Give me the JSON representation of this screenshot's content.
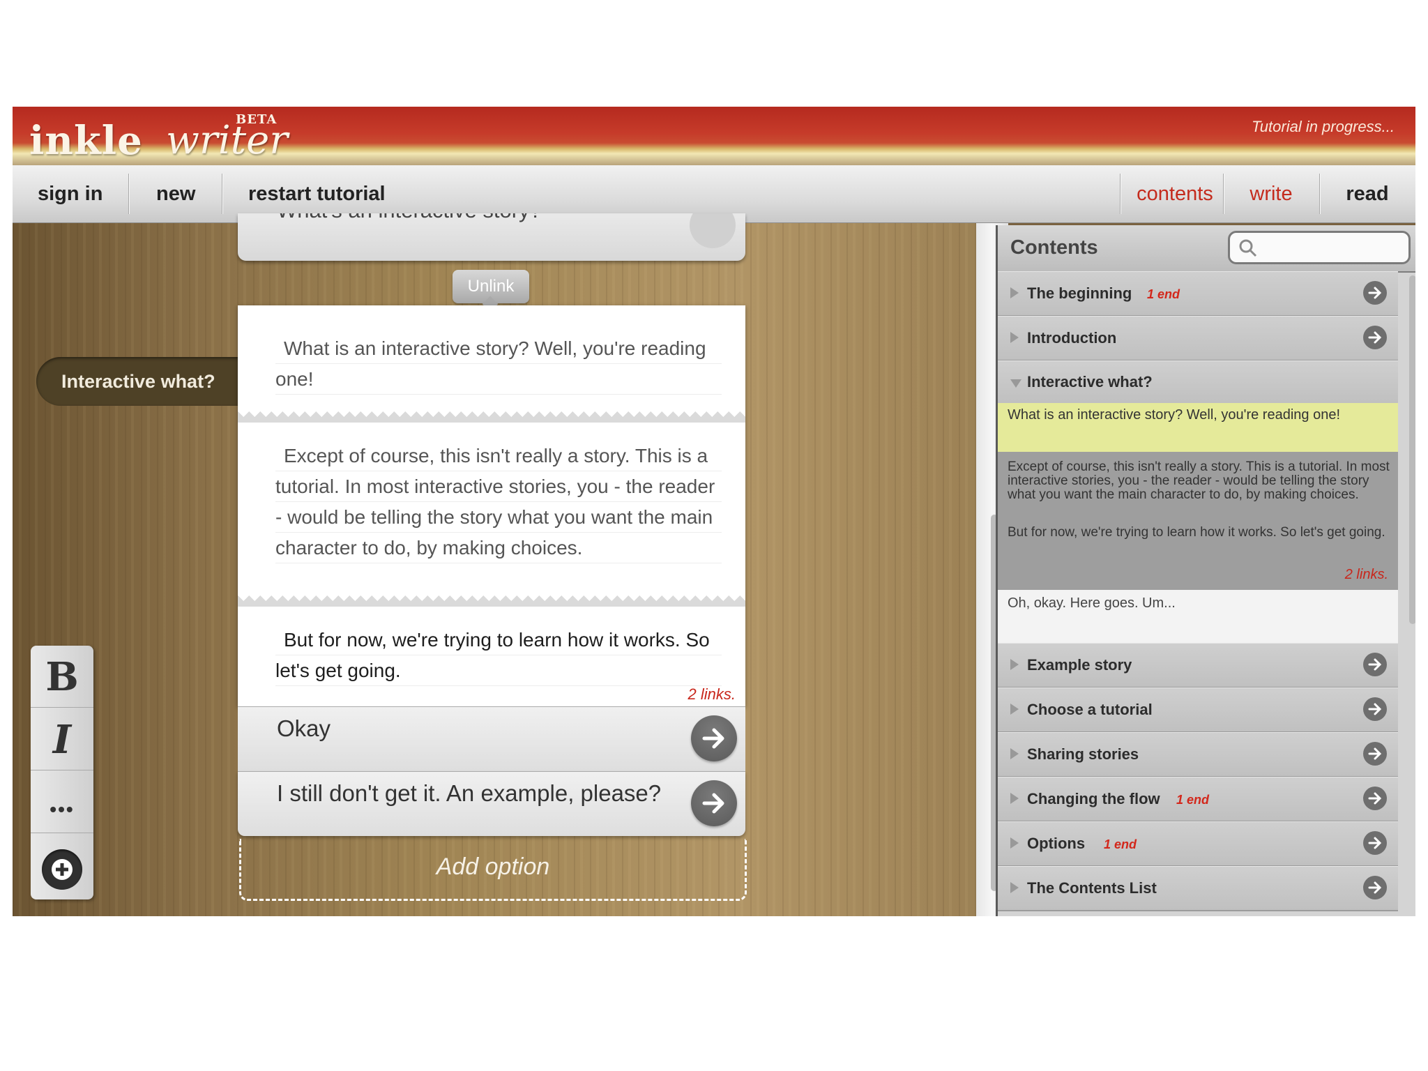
{
  "header": {
    "logo_main": "inkle",
    "logo_script": "writer",
    "logo_badge": "BETA",
    "status": "Tutorial in progress..."
  },
  "toolbar": {
    "sign_in": "sign in",
    "new": "new",
    "restart": "restart tutorial",
    "contents": "contents",
    "write": "write",
    "read": "read"
  },
  "editor": {
    "prev_card_text": "What's an interactive story?",
    "unlink": "Unlink",
    "tag": "Interactive what?",
    "paragraphs": [
      "What is an interactive story? Well, you're reading one!",
      "Except of course, this isn't really a story. This is a tutorial. In most interactive stories, you - the reader - would be telling the story what you want the main character to do, by making choices.",
      "But for now, we're trying to learn how it works. So let's get going."
    ],
    "links_count": "2 links.",
    "options": [
      "Okay",
      "I still don't get it. An example, please?"
    ],
    "add_option": "Add option"
  },
  "format": {
    "bold": "B",
    "italic": "I",
    "more": "•••"
  },
  "contents_panel": {
    "title": "Contents",
    "search_placeholder": "",
    "sections_top": [
      {
        "name": "The beginning",
        "ends": "1 end"
      },
      {
        "name": "Introduction",
        "ends": ""
      }
    ],
    "expanded": {
      "name": "Interactive what?",
      "highlight": "What is an interactive story? Well, you're reading one!",
      "para1": "Except of course, this isn't really a story. This is a tutorial. In most interactive stories, you - the reader - would be telling the story what you want the main character to do, by making choices.",
      "para2": "But for now, we're trying to learn how it works. So let's get going.",
      "links": "2 links.",
      "next": "Oh, okay. Here goes. Um..."
    },
    "sections_bottom": [
      {
        "name": "Example story",
        "ends": ""
      },
      {
        "name": "Choose a tutorial",
        "ends": ""
      },
      {
        "name": "Sharing stories",
        "ends": ""
      },
      {
        "name": "Changing the flow",
        "ends": "1 end"
      },
      {
        "name": "Options",
        "ends": "1 end"
      },
      {
        "name": "The Contents List",
        "ends": ""
      }
    ]
  },
  "colors": {
    "header_red": "#c63b2a",
    "link_red": "#c8261b",
    "highlight": "#e5ea9a"
  }
}
